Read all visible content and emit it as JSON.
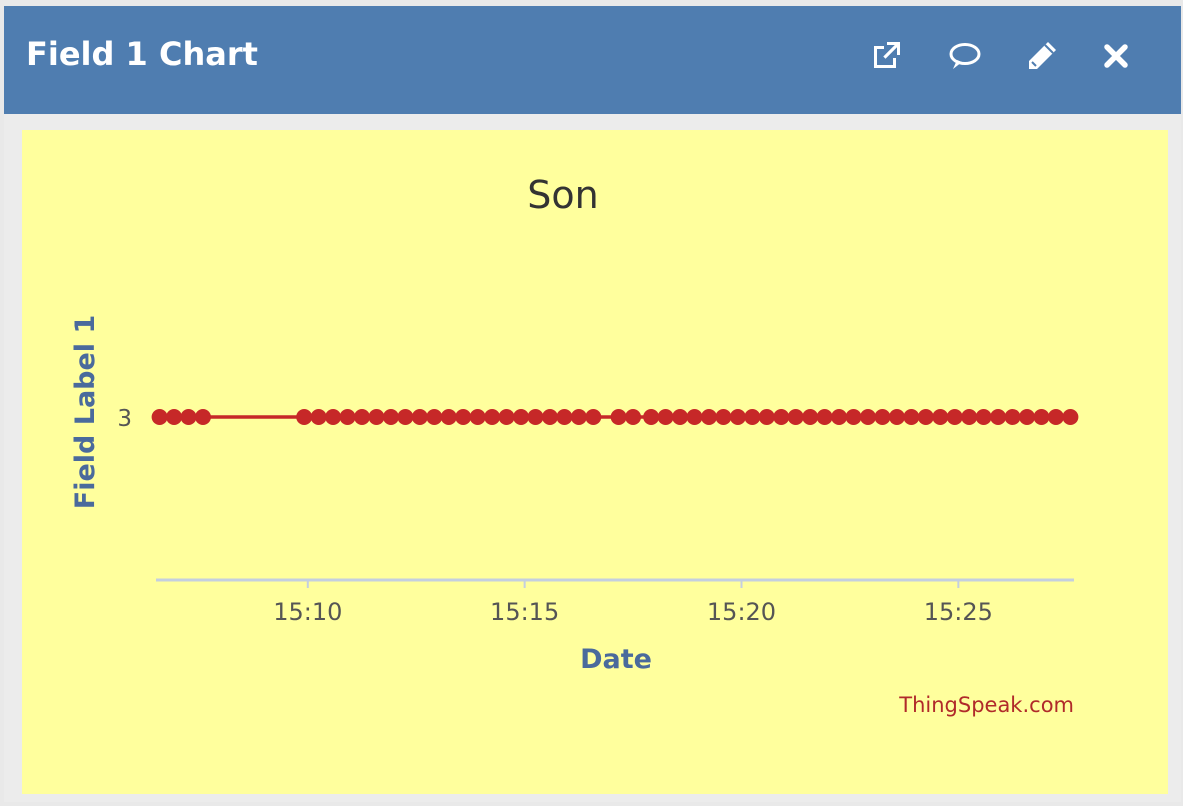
{
  "header": {
    "title": "Field 1 Chart",
    "icons": [
      "external-link-icon",
      "comment-icon",
      "pencil-icon",
      "close-icon"
    ]
  },
  "colors": {
    "header_bg": "#4f7db0",
    "plot_bg": "#ffff9d",
    "series": "#c62828",
    "axis_label": "#4a6a9c",
    "watermark": "#b02a2a"
  },
  "chart_data": {
    "type": "line",
    "title": "Son",
    "xlabel": "Date",
    "ylabel": "Field Label 1",
    "y_ticks": [
      "3"
    ],
    "x_ticks": [
      "15:10",
      "15:15",
      "15:20",
      "15:25"
    ],
    "x_domain": [
      "15:06:30",
      "15:27:40"
    ],
    "grid": false,
    "legend": "none",
    "series": [
      {
        "x": [
          "15:06:35",
          "15:06:55",
          "15:07:15",
          "15:07:35",
          "15:09:55",
          "15:10:15",
          "15:10:35",
          "15:10:55",
          "15:11:15",
          "15:11:35",
          "15:11:55",
          "15:12:15",
          "15:12:35",
          "15:12:55",
          "15:13:15",
          "15:13:35",
          "15:13:55",
          "15:14:15",
          "15:14:35",
          "15:14:55",
          "15:15:15",
          "15:15:35",
          "15:15:55",
          "15:16:15",
          "15:16:35",
          "15:17:10",
          "15:17:30",
          "15:17:55",
          "15:18:15",
          "15:18:35",
          "15:18:55",
          "15:19:15",
          "15:19:35",
          "15:19:55",
          "15:20:15",
          "15:20:35",
          "15:20:55",
          "15:21:15",
          "15:21:35",
          "15:21:55",
          "15:22:15",
          "15:22:35",
          "15:22:55",
          "15:23:15",
          "15:23:35",
          "15:23:55",
          "15:24:15",
          "15:24:35",
          "15:24:55",
          "15:25:15",
          "15:25:35",
          "15:25:55",
          "15:26:15",
          "15:26:35",
          "15:26:55",
          "15:27:15",
          "15:27:35"
        ],
        "y_value": 3
      }
    ]
  },
  "watermark": "ThingSpeak.com"
}
